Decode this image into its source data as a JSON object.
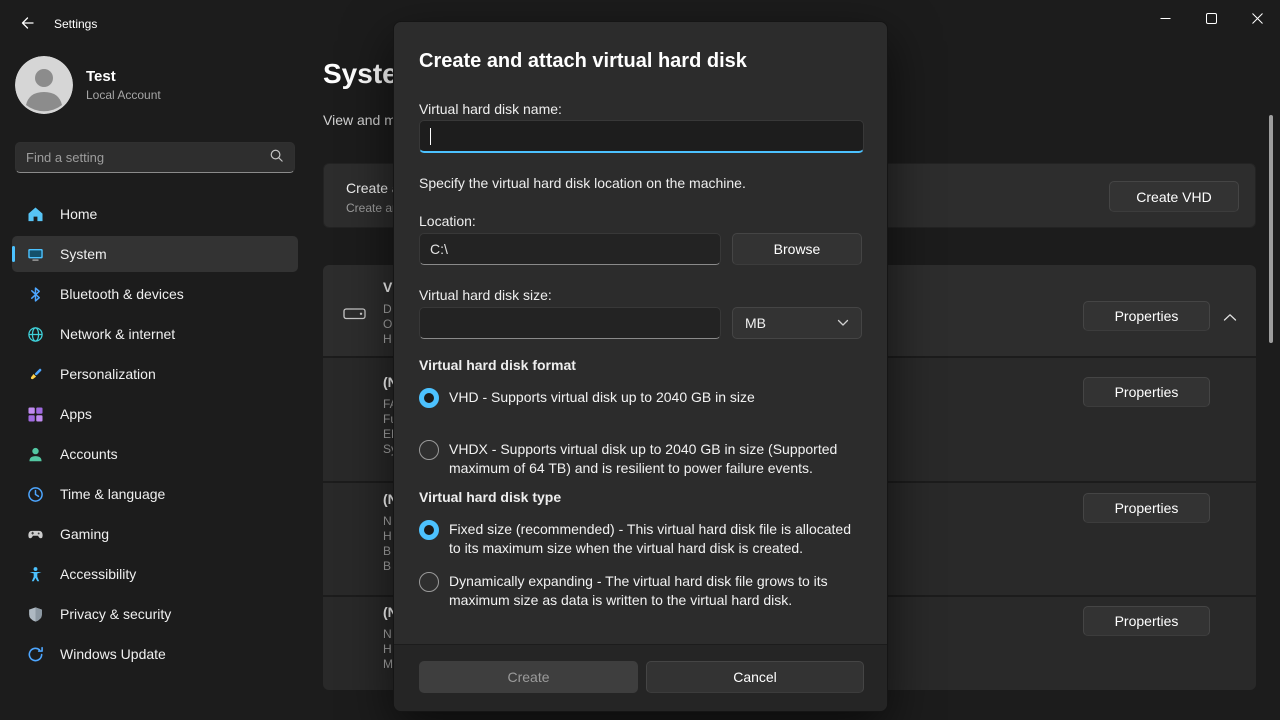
{
  "window": {
    "title": "Settings"
  },
  "colors": {
    "accent": "#4cc2ff"
  },
  "sidebar": {
    "user": {
      "name": "Test",
      "type": "Local Account"
    },
    "search_placeholder": "Find a setting",
    "items": [
      {
        "label": "Home",
        "icon": "home-icon",
        "selected": false
      },
      {
        "label": "System",
        "icon": "system-icon",
        "selected": true
      },
      {
        "label": "Bluetooth & devices",
        "icon": "bluetooth-icon",
        "selected": false
      },
      {
        "label": "Network & internet",
        "icon": "network-icon",
        "selected": false
      },
      {
        "label": "Personalization",
        "icon": "personalization-icon",
        "selected": false
      },
      {
        "label": "Apps",
        "icon": "apps-icon",
        "selected": false
      },
      {
        "label": "Accounts",
        "icon": "accounts-icon",
        "selected": false
      },
      {
        "label": "Time & language",
        "icon": "time-language-icon",
        "selected": false
      },
      {
        "label": "Gaming",
        "icon": "gaming-icon",
        "selected": false
      },
      {
        "label": "Accessibility",
        "icon": "accessibility-icon",
        "selected": false
      },
      {
        "label": "Privacy & security",
        "icon": "privacy-security-icon",
        "selected": false
      },
      {
        "label": "Windows Update",
        "icon": "windows-update-icon",
        "selected": false
      }
    ]
  },
  "main": {
    "page_title": "System",
    "page_subtitle_partial": "View and m",
    "vhd_card": {
      "title_partial": "Create a",
      "subtitle_partial": "Create an",
      "button_label": "Create VHD"
    },
    "disk_rows": [
      {
        "lines": [
          "V",
          "D",
          "O",
          "H"
        ],
        "button_label": "Properties",
        "expanded": true
      },
      {
        "lines": [
          "(N",
          "FA",
          "Fu",
          "EF",
          "Sy"
        ],
        "button_label": "Properties",
        "expanded": false
      },
      {
        "lines": [
          "(N",
          "N",
          "H",
          "B",
          "B"
        ],
        "button_label": "Properties",
        "expanded": false
      },
      {
        "lines": [
          "(N",
          "N",
          "H",
          "M"
        ],
        "button_label": "Properties",
        "expanded": false
      }
    ]
  },
  "dialog": {
    "title": "Create and attach virtual hard disk",
    "name_label": "Virtual hard disk name:",
    "name_value": "",
    "location_instruction": "Specify the virtual hard disk location on the machine.",
    "location_label": "Location:",
    "location_value": "C:\\",
    "browse_button_label": "Browse",
    "size_label": "Virtual hard disk size:",
    "size_value": "",
    "size_unit": "MB",
    "format_heading": "Virtual hard disk format",
    "format_options": [
      {
        "label": "VHD - Supports virtual disk up to 2040 GB in size",
        "selected": true
      },
      {
        "label": "VHDX - Supports virtual disk up to 2040 GB in size (Supported maximum of 64 TB) and is resilient to power failure events.",
        "selected": false
      }
    ],
    "type_heading": "Virtual hard disk type",
    "type_options": [
      {
        "label": "Fixed size (recommended) - This virtual hard disk file is allocated to its maximum size when the virtual hard disk is created.",
        "selected": true
      },
      {
        "label": "Dynamically expanding - The virtual hard disk file grows to its maximum size as data is written to the virtual hard disk.",
        "selected": false
      }
    ],
    "create_button_label": "Create",
    "create_button_enabled": false,
    "cancel_button_label": "Cancel"
  }
}
